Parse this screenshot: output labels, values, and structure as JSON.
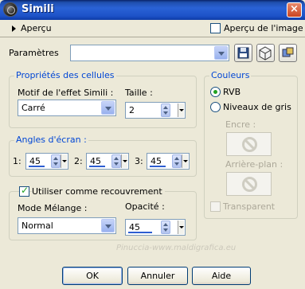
{
  "window": {
    "title": "Simili",
    "close": "×"
  },
  "preview": {
    "label": "Aperçu",
    "image_label": "Aperçu de l'image"
  },
  "params": {
    "label": "Paramètres",
    "value": ""
  },
  "cell_props": {
    "title": "Propriétés des cellules",
    "motif_label": "Motif de l'effet Simili :",
    "motif_value": "Carré",
    "size_label": "Taille :",
    "size_value": "2"
  },
  "angles": {
    "title": "Angles d'écran :",
    "items": [
      {
        "label": "1:",
        "value": "45"
      },
      {
        "label": "2:",
        "value": "45"
      },
      {
        "label": "3:",
        "value": "45"
      }
    ]
  },
  "overlay": {
    "label": "Utiliser comme recouvrement",
    "checked": true,
    "blend_label": "Mode Mélange :",
    "blend_value": "Normal",
    "opacity_label": "Opacité :",
    "opacity_value": "45"
  },
  "colors": {
    "title": "Couleurs",
    "rgb_label": "RVB",
    "gray_label": "Niveaux de gris",
    "ink_label": "Encre :",
    "bg_label": "Arrière-plan :",
    "transparent_label": "Transparent"
  },
  "buttons": {
    "ok": "OK",
    "cancel": "Annuler",
    "help": "Aide"
  },
  "watermark": "Pinuccia-www.maldigrafica.eu"
}
